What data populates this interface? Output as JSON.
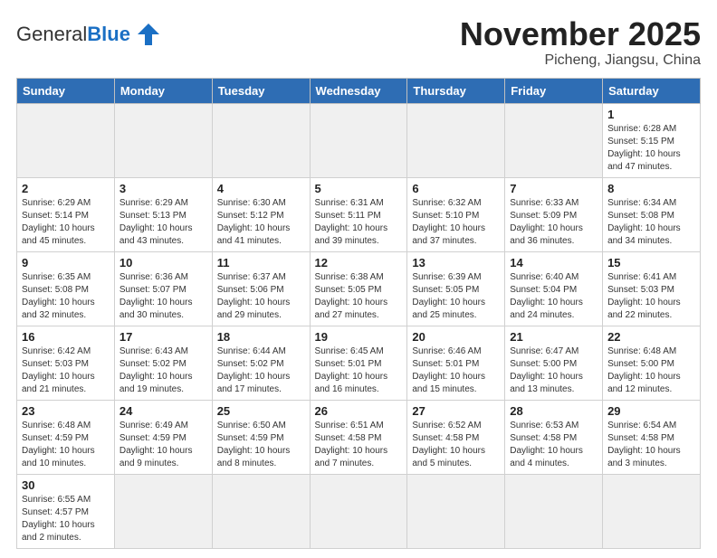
{
  "header": {
    "logo_general": "General",
    "logo_blue": "Blue",
    "title": "November 2025",
    "subtitle": "Picheng, Jiangsu, China"
  },
  "days_of_week": [
    "Sunday",
    "Monday",
    "Tuesday",
    "Wednesday",
    "Thursday",
    "Friday",
    "Saturday"
  ],
  "weeks": [
    [
      {
        "day": "",
        "empty": true
      },
      {
        "day": "",
        "empty": true
      },
      {
        "day": "",
        "empty": true
      },
      {
        "day": "",
        "empty": true
      },
      {
        "day": "",
        "empty": true
      },
      {
        "day": "",
        "empty": true
      },
      {
        "day": "1",
        "info": "Sunrise: 6:28 AM\nSunset: 5:15 PM\nDaylight: 10 hours and 47 minutes."
      }
    ],
    [
      {
        "day": "2",
        "info": "Sunrise: 6:29 AM\nSunset: 5:14 PM\nDaylight: 10 hours and 45 minutes."
      },
      {
        "day": "3",
        "info": "Sunrise: 6:29 AM\nSunset: 5:13 PM\nDaylight: 10 hours and 43 minutes."
      },
      {
        "day": "4",
        "info": "Sunrise: 6:30 AM\nSunset: 5:12 PM\nDaylight: 10 hours and 41 minutes."
      },
      {
        "day": "5",
        "info": "Sunrise: 6:31 AM\nSunset: 5:11 PM\nDaylight: 10 hours and 39 minutes."
      },
      {
        "day": "6",
        "info": "Sunrise: 6:32 AM\nSunset: 5:10 PM\nDaylight: 10 hours and 37 minutes."
      },
      {
        "day": "7",
        "info": "Sunrise: 6:33 AM\nSunset: 5:09 PM\nDaylight: 10 hours and 36 minutes."
      },
      {
        "day": "8",
        "info": "Sunrise: 6:34 AM\nSunset: 5:08 PM\nDaylight: 10 hours and 34 minutes."
      }
    ],
    [
      {
        "day": "9",
        "info": "Sunrise: 6:35 AM\nSunset: 5:08 PM\nDaylight: 10 hours and 32 minutes."
      },
      {
        "day": "10",
        "info": "Sunrise: 6:36 AM\nSunset: 5:07 PM\nDaylight: 10 hours and 30 minutes."
      },
      {
        "day": "11",
        "info": "Sunrise: 6:37 AM\nSunset: 5:06 PM\nDaylight: 10 hours and 29 minutes."
      },
      {
        "day": "12",
        "info": "Sunrise: 6:38 AM\nSunset: 5:05 PM\nDaylight: 10 hours and 27 minutes."
      },
      {
        "day": "13",
        "info": "Sunrise: 6:39 AM\nSunset: 5:05 PM\nDaylight: 10 hours and 25 minutes."
      },
      {
        "day": "14",
        "info": "Sunrise: 6:40 AM\nSunset: 5:04 PM\nDaylight: 10 hours and 24 minutes."
      },
      {
        "day": "15",
        "info": "Sunrise: 6:41 AM\nSunset: 5:03 PM\nDaylight: 10 hours and 22 minutes."
      }
    ],
    [
      {
        "day": "16",
        "info": "Sunrise: 6:42 AM\nSunset: 5:03 PM\nDaylight: 10 hours and 21 minutes."
      },
      {
        "day": "17",
        "info": "Sunrise: 6:43 AM\nSunset: 5:02 PM\nDaylight: 10 hours and 19 minutes."
      },
      {
        "day": "18",
        "info": "Sunrise: 6:44 AM\nSunset: 5:02 PM\nDaylight: 10 hours and 17 minutes."
      },
      {
        "day": "19",
        "info": "Sunrise: 6:45 AM\nSunset: 5:01 PM\nDaylight: 10 hours and 16 minutes."
      },
      {
        "day": "20",
        "info": "Sunrise: 6:46 AM\nSunset: 5:01 PM\nDaylight: 10 hours and 15 minutes."
      },
      {
        "day": "21",
        "info": "Sunrise: 6:47 AM\nSunset: 5:00 PM\nDaylight: 10 hours and 13 minutes."
      },
      {
        "day": "22",
        "info": "Sunrise: 6:48 AM\nSunset: 5:00 PM\nDaylight: 10 hours and 12 minutes."
      }
    ],
    [
      {
        "day": "23",
        "info": "Sunrise: 6:48 AM\nSunset: 4:59 PM\nDaylight: 10 hours and 10 minutes."
      },
      {
        "day": "24",
        "info": "Sunrise: 6:49 AM\nSunset: 4:59 PM\nDaylight: 10 hours and 9 minutes."
      },
      {
        "day": "25",
        "info": "Sunrise: 6:50 AM\nSunset: 4:59 PM\nDaylight: 10 hours and 8 minutes."
      },
      {
        "day": "26",
        "info": "Sunrise: 6:51 AM\nSunset: 4:58 PM\nDaylight: 10 hours and 7 minutes."
      },
      {
        "day": "27",
        "info": "Sunrise: 6:52 AM\nSunset: 4:58 PM\nDaylight: 10 hours and 5 minutes."
      },
      {
        "day": "28",
        "info": "Sunrise: 6:53 AM\nSunset: 4:58 PM\nDaylight: 10 hours and 4 minutes."
      },
      {
        "day": "29",
        "info": "Sunrise: 6:54 AM\nSunset: 4:58 PM\nDaylight: 10 hours and 3 minutes."
      }
    ],
    [
      {
        "day": "30",
        "info": "Sunrise: 6:55 AM\nSunset: 4:57 PM\nDaylight: 10 hours and 2 minutes."
      },
      {
        "day": "",
        "empty": true
      },
      {
        "day": "",
        "empty": true
      },
      {
        "day": "",
        "empty": true
      },
      {
        "day": "",
        "empty": true
      },
      {
        "day": "",
        "empty": true
      },
      {
        "day": "",
        "empty": true
      }
    ]
  ]
}
